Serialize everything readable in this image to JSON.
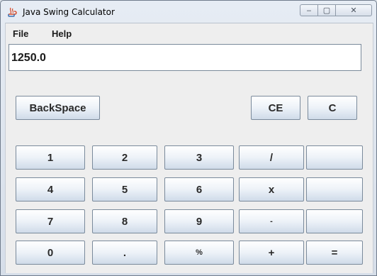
{
  "window": {
    "title": "Java Swing Calculator",
    "controls": {
      "minimize": "‒",
      "maximize": "▢",
      "close": "✕"
    }
  },
  "menu": {
    "items": [
      "File",
      "Help"
    ]
  },
  "display": {
    "value": "1250.0"
  },
  "controls": {
    "backspace": "BackSpace",
    "ce": "CE",
    "c": "C"
  },
  "keypad": {
    "row1": [
      "1",
      "2",
      "3",
      "/",
      ""
    ],
    "row2": [
      "4",
      "5",
      "6",
      "x",
      ""
    ],
    "row3": [
      "7",
      "8",
      "9",
      "-",
      ""
    ],
    "row4": [
      "0",
      ".",
      "%",
      "+",
      "="
    ]
  },
  "colors": {
    "button_gradient_bottom": "#cfdbe9",
    "client_bg": "#eeeeee",
    "border": "#7a8a9b"
  }
}
